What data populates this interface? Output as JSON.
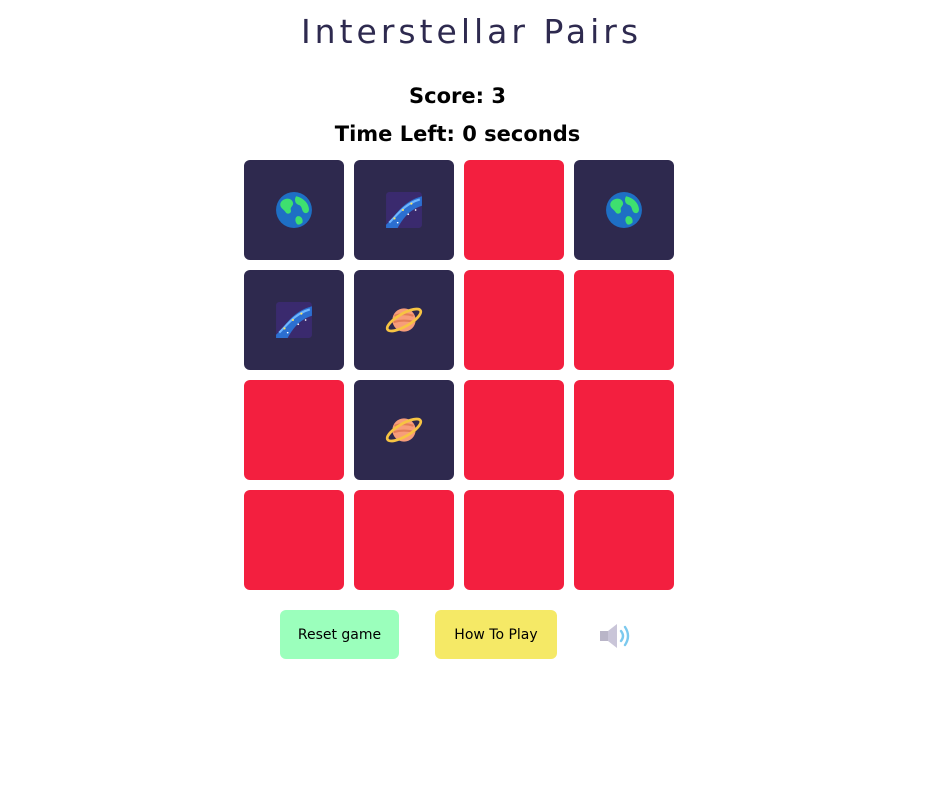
{
  "title": "Interstellar Pairs",
  "score_text": "Score: 3",
  "time_text": "Time Left: 0 seconds",
  "cards": [
    {
      "state": "flipped",
      "icon": "earth-icon"
    },
    {
      "state": "flipped",
      "icon": "milky-way-icon"
    },
    {
      "state": "hidden",
      "icon": ""
    },
    {
      "state": "flipped",
      "icon": "earth-icon"
    },
    {
      "state": "flipped",
      "icon": "milky-way-icon"
    },
    {
      "state": "flipped",
      "icon": "ringed-planet-icon"
    },
    {
      "state": "hidden",
      "icon": ""
    },
    {
      "state": "hidden",
      "icon": ""
    },
    {
      "state": "hidden",
      "icon": ""
    },
    {
      "state": "flipped",
      "icon": "ringed-planet-icon"
    },
    {
      "state": "hidden",
      "icon": ""
    },
    {
      "state": "hidden",
      "icon": ""
    },
    {
      "state": "hidden",
      "icon": ""
    },
    {
      "state": "hidden",
      "icon": ""
    },
    {
      "state": "hidden",
      "icon": ""
    },
    {
      "state": "hidden",
      "icon": ""
    }
  ],
  "buttons": {
    "reset_label": "Reset game",
    "howto_label": "How To Play"
  },
  "sound_icon": "speaker-icon",
  "colors": {
    "card_back": "#f31f3f",
    "card_face": "#2e294e",
    "reset_bg": "#9bffbc",
    "howto_bg": "#f5e966",
    "title": "#2e2a4f"
  }
}
